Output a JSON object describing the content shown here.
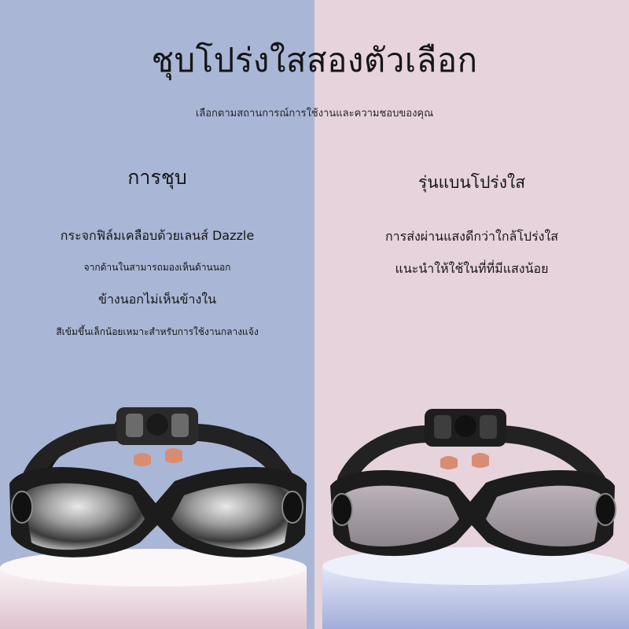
{
  "title": "ชุบโปร่งใสสองตัวเลือก",
  "subtitle": "เลือกตามสถานการณ์การใช้งานและความชอบของคุณ",
  "left": {
    "heading": "การชุบ",
    "line1": "กระจกฟิล์มเคลือบด้วยเลนส์ Dazzle",
    "line2": "จากด้านในสามารถมองเห็นด้านนอก",
    "line3": "ข้างนอกไม่เห็นข้างใน",
    "line4": "สีเข้มขึ้นเล็กน้อยเหมาะสำหรับการใช้งานกลางแจ้ง"
  },
  "right": {
    "heading": "รุ่นแบนโปร่งใส",
    "line1": "การส่งผ่านแสงดีกว่าใกล้โปร่งใส",
    "line2": "แนะนำให้ใช้ในที่ที่มีแสงน้อย"
  },
  "colors": {
    "left_background": "#a9b6d6",
    "right_background": "#e6d3dc",
    "left_pedestal": "#efe3ea",
    "right_pedestal": "#c6cdeb",
    "goggle_frame": "#1c1c1c"
  },
  "icons": [
    "mirrored-goggles-icon",
    "clear-goggles-icon"
  ]
}
